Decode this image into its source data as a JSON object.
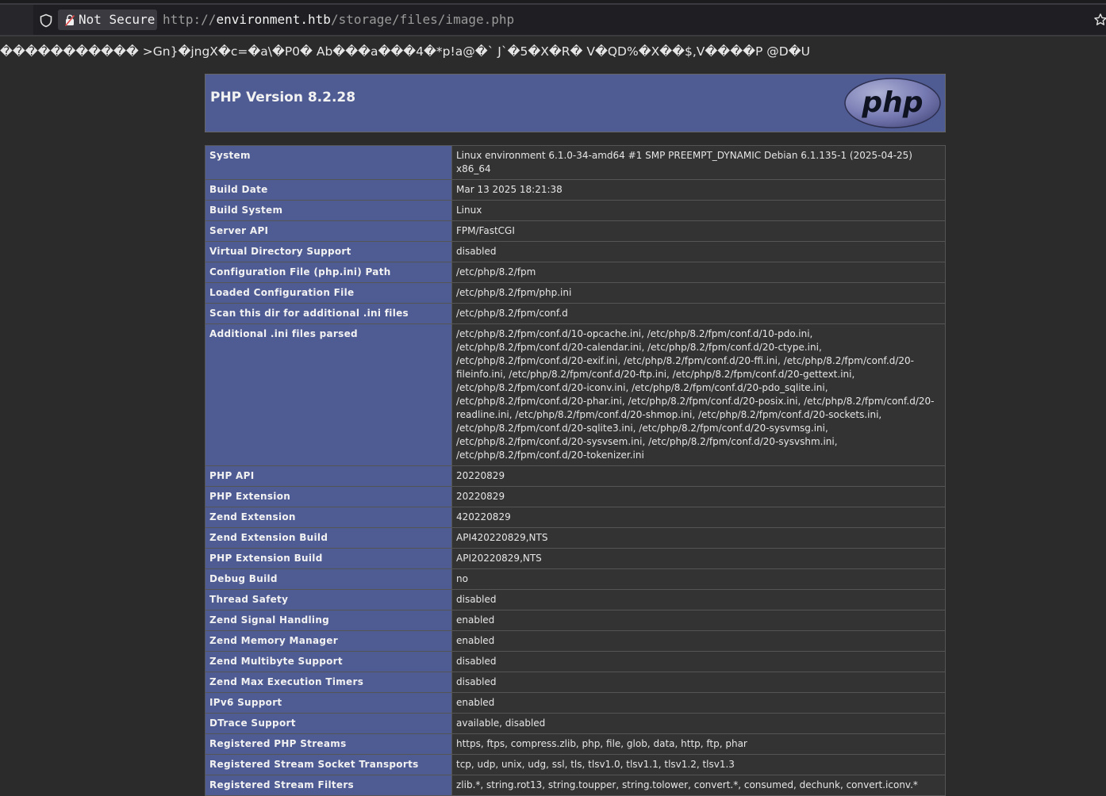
{
  "browser": {
    "security_label": "Not Secure",
    "url_scheme": "http://",
    "url_host": "environment.htb",
    "url_path": "/storage/files/image.php",
    "icons": [
      "shield-icon",
      "lock-icon",
      "star-icon"
    ]
  },
  "garbage_text": "����������� >Gn}�jngX�c=�a\\�P0� Ab���a���4�*p!a@�` J`�5�X�R� V�QD%�X��$,V����P @D�U",
  "phpinfo": {
    "title": "PHP Version 8.2.28",
    "logo_text": "php",
    "rows": [
      {
        "key": "System",
        "value": "Linux environment 6.1.0-34-amd64 #1 SMP PREEMPT_DYNAMIC Debian 6.1.135-1 (2025-04-25) x86_64"
      },
      {
        "key": "Build Date",
        "value": "Mar 13 2025 18:21:38"
      },
      {
        "key": "Build System",
        "value": "Linux"
      },
      {
        "key": "Server API",
        "value": "FPM/FastCGI"
      },
      {
        "key": "Virtual Directory Support",
        "value": "disabled"
      },
      {
        "key": "Configuration File (php.ini) Path",
        "value": "/etc/php/8.2/fpm"
      },
      {
        "key": "Loaded Configuration File",
        "value": "/etc/php/8.2/fpm/php.ini"
      },
      {
        "key": "Scan this dir for additional .ini files",
        "value": "/etc/php/8.2/fpm/conf.d"
      },
      {
        "key": "Additional .ini files parsed",
        "value": "/etc/php/8.2/fpm/conf.d/10-opcache.ini, /etc/php/8.2/fpm/conf.d/10-pdo.ini, /etc/php/8.2/fpm/conf.d/20-calendar.ini, /etc/php/8.2/fpm/conf.d/20-ctype.ini, /etc/php/8.2/fpm/conf.d/20-exif.ini, /etc/php/8.2/fpm/conf.d/20-ffi.ini, /etc/php/8.2/fpm/conf.d/20-fileinfo.ini, /etc/php/8.2/fpm/conf.d/20-ftp.ini, /etc/php/8.2/fpm/conf.d/20-gettext.ini, /etc/php/8.2/fpm/conf.d/20-iconv.ini, /etc/php/8.2/fpm/conf.d/20-pdo_sqlite.ini, /etc/php/8.2/fpm/conf.d/20-phar.ini, /etc/php/8.2/fpm/conf.d/20-posix.ini, /etc/php/8.2/fpm/conf.d/20-readline.ini, /etc/php/8.2/fpm/conf.d/20-shmop.ini, /etc/php/8.2/fpm/conf.d/20-sockets.ini, /etc/php/8.2/fpm/conf.d/20-sqlite3.ini, /etc/php/8.2/fpm/conf.d/20-sysvmsg.ini, /etc/php/8.2/fpm/conf.d/20-sysvsem.ini, /etc/php/8.2/fpm/conf.d/20-sysvshm.ini, /etc/php/8.2/fpm/conf.d/20-tokenizer.ini"
      },
      {
        "key": "PHP API",
        "value": "20220829"
      },
      {
        "key": "PHP Extension",
        "value": "20220829"
      },
      {
        "key": "Zend Extension",
        "value": "420220829"
      },
      {
        "key": "Zend Extension Build",
        "value": "API420220829,NTS"
      },
      {
        "key": "PHP Extension Build",
        "value": "API20220829,NTS"
      },
      {
        "key": "Debug Build",
        "value": "no"
      },
      {
        "key": "Thread Safety",
        "value": "disabled"
      },
      {
        "key": "Zend Signal Handling",
        "value": "enabled"
      },
      {
        "key": "Zend Memory Manager",
        "value": "enabled"
      },
      {
        "key": "Zend Multibyte Support",
        "value": "disabled"
      },
      {
        "key": "Zend Max Execution Timers",
        "value": "disabled"
      },
      {
        "key": "IPv6 Support",
        "value": "enabled"
      },
      {
        "key": "DTrace Support",
        "value": "available, disabled"
      },
      {
        "key": "Registered PHP Streams",
        "value": "https, ftps, compress.zlib, php, file, glob, data, http, ftp, phar"
      },
      {
        "key": "Registered Stream Socket Transports",
        "value": "tcp, udp, unix, udg, ssl, tls, tlsv1.0, tlsv1.1, tlsv1.2, tlsv1.3"
      },
      {
        "key": "Registered Stream Filters",
        "value": "zlib.*, string.rot13, string.toupper, string.tolower, convert.*, consumed, dechunk, convert.iconv.*"
      }
    ]
  },
  "colors": {
    "page_bg": "#2b2b2b",
    "header_bg": "#4f5b93",
    "key_cell_bg": "#4f5b93",
    "value_cell_bg": "#333333",
    "border": "#555555"
  }
}
